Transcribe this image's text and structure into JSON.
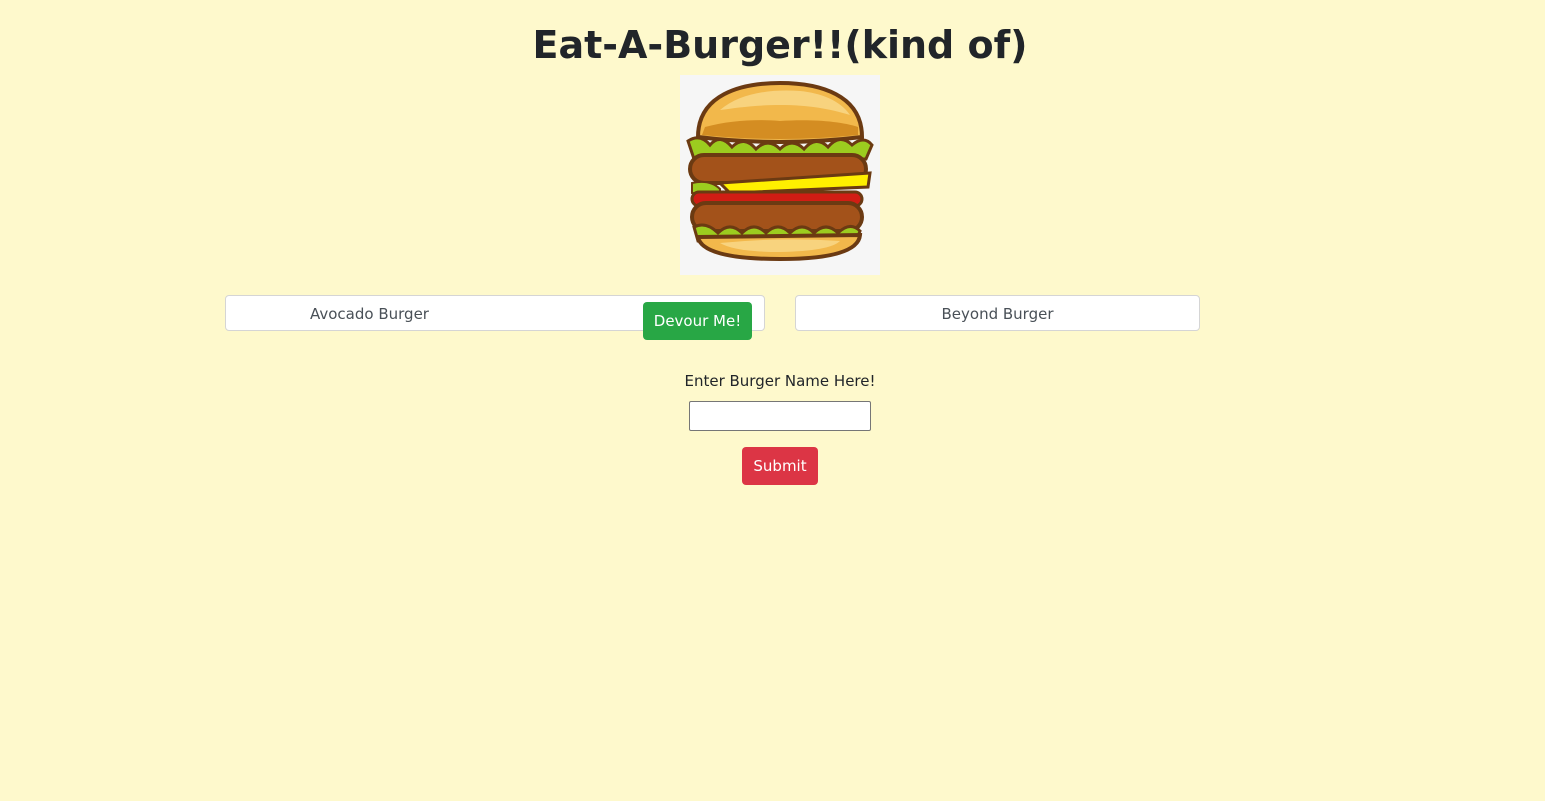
{
  "header": {
    "title": "Eat-A-Burger!!(kind of)"
  },
  "image": {
    "icon": "burger-illustration"
  },
  "uneaten": {
    "items": [
      {
        "name": "Avocado Burger",
        "button_label": "Devour Me!"
      }
    ]
  },
  "eaten": {
    "items": [
      {
        "name": "Beyond Burger"
      }
    ]
  },
  "form": {
    "label": "Enter Burger Name Here!",
    "input_value": "",
    "submit_label": "Submit"
  },
  "colors": {
    "background": "#fef9cc",
    "devour_button": "#28a745",
    "submit_button": "#dc3545"
  }
}
